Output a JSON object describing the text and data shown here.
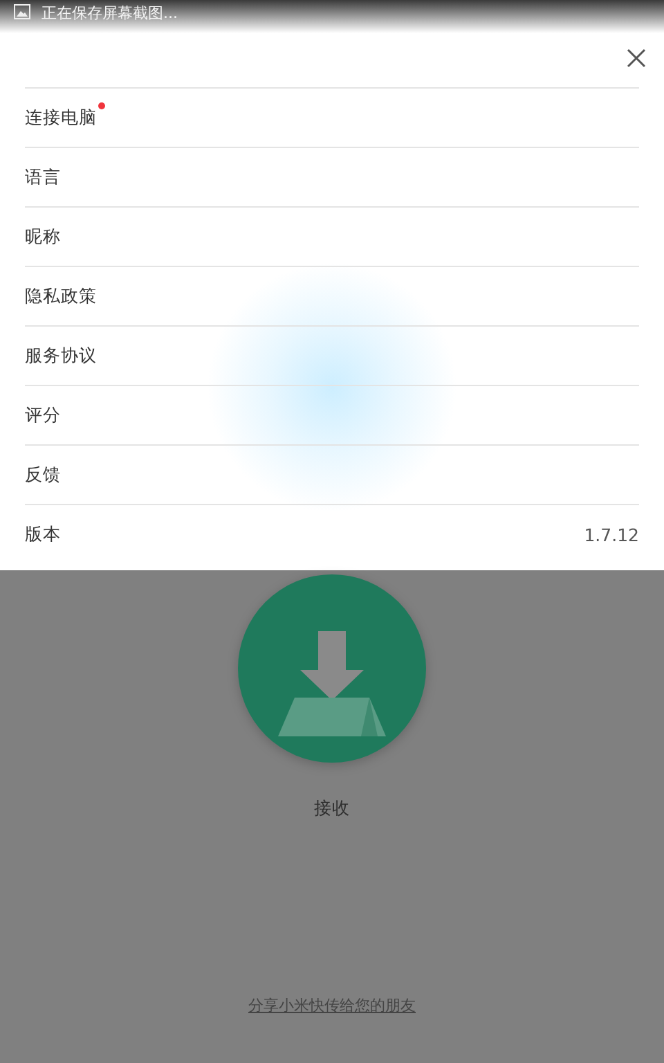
{
  "status_bar": {
    "notification": "正在保存屏幕截图..."
  },
  "menu": {
    "items": [
      {
        "label": "连接电脑",
        "badge": true
      },
      {
        "label": "语言",
        "badge": false
      },
      {
        "label": "昵称",
        "badge": false
      },
      {
        "label": "隐私政策",
        "badge": false
      },
      {
        "label": "服务协议",
        "badge": false
      },
      {
        "label": "评分",
        "badge": false
      },
      {
        "label": "反馈",
        "badge": false
      },
      {
        "label": "版本",
        "badge": false,
        "value": "1.7.12"
      }
    ]
  },
  "receive": {
    "label": "接收"
  },
  "share_link": "分享小米快传给您的朋友"
}
